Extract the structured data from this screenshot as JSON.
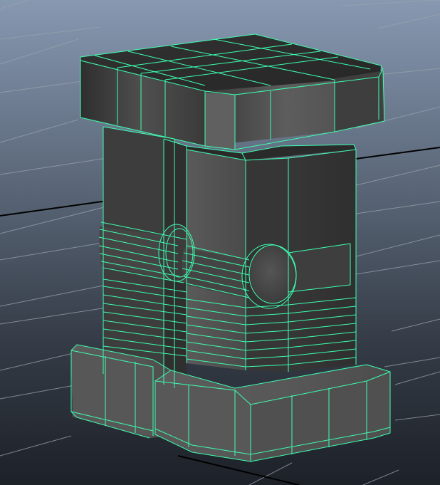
{
  "viewport": {
    "type": "3d-modeling-perspective-viewport",
    "background_top_color": "#8597b0",
    "background_bottom_color": "#1c2026",
    "grid_color": "#9aa3ad",
    "grid_axis_color": "#000000"
  },
  "model": {
    "description": "pillar",
    "selected": true,
    "wireframe_color": "#3dffb0",
    "face_color": "#4c4c4c"
  }
}
